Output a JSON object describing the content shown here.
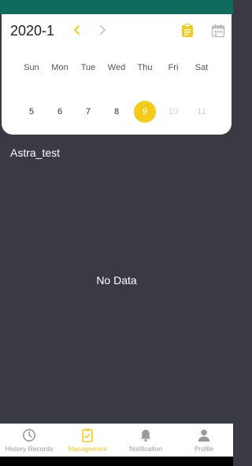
{
  "calendar": {
    "month_label": "2020-1",
    "weekdays": [
      "Sun",
      "Mon",
      "Tue",
      "Wed",
      "Thu",
      "Fri",
      "Sat"
    ],
    "days": [
      "5",
      "6",
      "7",
      "8",
      "9",
      "10",
      "11"
    ],
    "selected_day": "9"
  },
  "content": {
    "user_name": "Astra_test",
    "empty_message": "No Data"
  },
  "nav": {
    "items": [
      {
        "label": "History Records",
        "icon": "clock-icon"
      },
      {
        "label": "Management",
        "icon": "clipboard-icon"
      },
      {
        "label": "Notification",
        "icon": "bell-icon"
      },
      {
        "label": "Profile",
        "icon": "person-icon"
      }
    ],
    "active_index": 1
  },
  "colors": {
    "accent": "#f5cb1b",
    "status_bar": "#0f6b5b",
    "background": "#3a3a45"
  }
}
